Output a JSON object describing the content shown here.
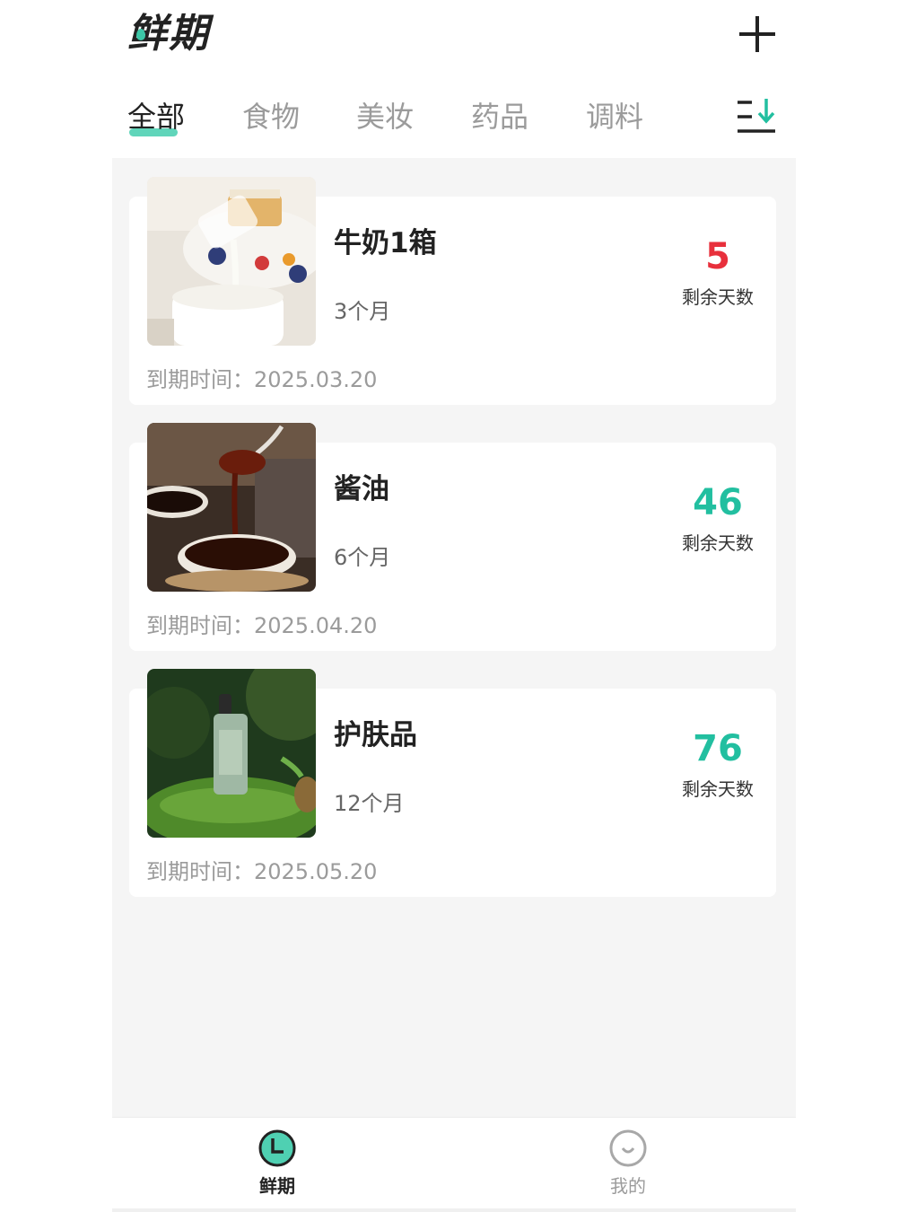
{
  "header": {
    "logo_text": "鲜期",
    "add_icon": "plus-icon"
  },
  "tabs": [
    {
      "label": "全部",
      "active": true
    },
    {
      "label": "食物",
      "active": false
    },
    {
      "label": "美妆",
      "active": false
    },
    {
      "label": "药品",
      "active": false
    },
    {
      "label": "调料",
      "active": false
    }
  ],
  "sort_icon": "sort-descending-icon",
  "items": [
    {
      "name": "牛奶1箱",
      "period": "3个月",
      "days_left": "5",
      "days_label": "剩余天数",
      "expire_label": "到期时间：",
      "expire_date": "2025.03.20",
      "days_color": "#e8303c",
      "image": "milk-pouring-photo"
    },
    {
      "name": "酱油",
      "period": "6个月",
      "days_left": "46",
      "days_label": "剩余天数",
      "expire_label": "到期时间：",
      "expire_date": "2025.04.20",
      "days_color": "#22bfa0",
      "image": "soy-sauce-spoon-photo"
    },
    {
      "name": "护肤品",
      "period": "12个月",
      "days_left": "76",
      "days_label": "剩余天数",
      "expire_label": "到期时间：",
      "expire_date": "2025.05.20",
      "days_color": "#22bfa0",
      "image": "serum-bottle-on-moss-photo"
    }
  ],
  "bottom_nav": [
    {
      "label": "鲜期",
      "icon": "clock-icon",
      "active": true
    },
    {
      "label": "我的",
      "icon": "smile-face-icon",
      "active": false
    }
  ],
  "colors": {
    "accent": "#3cc6a6",
    "urgent": "#e8303c",
    "muted": "#9b9b9b"
  }
}
